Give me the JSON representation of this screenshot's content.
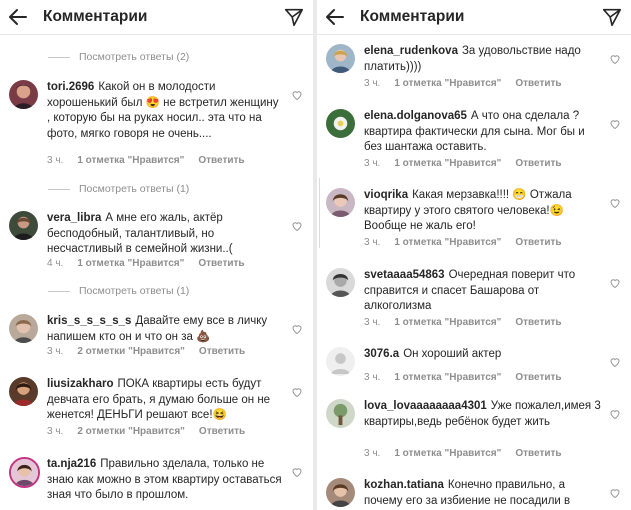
{
  "header": {
    "title": "Комментарии"
  },
  "left": {
    "view_replies": [
      {
        "label": "Посмотреть ответы (2)"
      },
      {
        "label": "Посмотреть ответы (1)"
      },
      {
        "label": "Посмотреть ответы (1)"
      }
    ],
    "comments": [
      {
        "user": "tori.2696",
        "text": "Какой он в молодости хорошенький был 😍 не встретил женщину , которую бы на руках носил.. эта что на фото, мягко говоря не очень....",
        "time": "3 ч.",
        "likes": "1 отметка \"Нравится\"",
        "reply": "Ответить"
      },
      {
        "user": "vera_libra",
        "text": "А мне его жаль, актёр бесподобный, талантливый, но несчастливый в семейной жизни..(",
        "time": "4 ч.",
        "likes": "1 отметка \"Нравится\"",
        "reply": "Ответить"
      },
      {
        "user": "kris_s_s_s_s_s",
        "text": "Давайте ему все в личку напишем кто он и что он за 💩",
        "time": "3 ч.",
        "likes": "2 отметки \"Нравится\"",
        "reply": "Ответить"
      },
      {
        "user": "liusizakharo",
        "text": "ПОКА квартиры есть будут девчата его брать, я думаю больше он не женется! ДЕНЬГИ решают все!😆",
        "time": "3 ч.",
        "likes": "2 отметки \"Нравится\"",
        "reply": "Ответить"
      },
      {
        "user": "ta.nja216",
        "text": "Правильно зделала, только не знаю как можно в этом квартиру оставаться зная что было в прошлом.",
        "time": "",
        "likes": "",
        "reply": ""
      }
    ]
  },
  "right": {
    "comments": [
      {
        "user": "elena_rudenkova",
        "text": "За удовольствие надо платить))))",
        "time": "3 ч.",
        "likes": "1 отметка \"Нравится\"",
        "reply": "Ответить"
      },
      {
        "user": "elena.dolganova65",
        "text": "А что она сделала ? квартира фактически для сына. Мог бы и без шантажа оставить.",
        "time": "3 ч.",
        "likes": "1 отметка \"Нравится\"",
        "reply": "Ответить"
      },
      {
        "user": "vioqrika",
        "text": "Какая мерзавка!!!! 😁 Отжала квартиру у этого святого человека!😉 Вообще не жаль его!",
        "time": "3 ч.",
        "likes": "1 отметка \"Нравится\"",
        "reply": "Ответить"
      },
      {
        "user": "svetaaaa54863",
        "text": "Очередная поверит что справится и спасет Башарова от алкоголизма",
        "time": "3 ч.",
        "likes": "1 отметка \"Нравится\"",
        "reply": "Ответить"
      },
      {
        "user": "3076.a",
        "text": "Он хороший актер",
        "time": "3 ч.",
        "likes": "1 отметка \"Нравится\"",
        "reply": "Ответить"
      },
      {
        "user": "lova_lovaaaaaaaa4301",
        "text": "Уже пожалел,имея 3 квартиры,ведь ребёнок будет жить",
        "time": "3 ч.",
        "likes": "1 отметка \"Нравится\"",
        "reply": "Ответить"
      },
      {
        "user": "kozhan.tatiana",
        "text": "Конечно правильно, а почему его за избиение не посадили в",
        "time": "",
        "likes": "",
        "reply": ""
      }
    ]
  }
}
